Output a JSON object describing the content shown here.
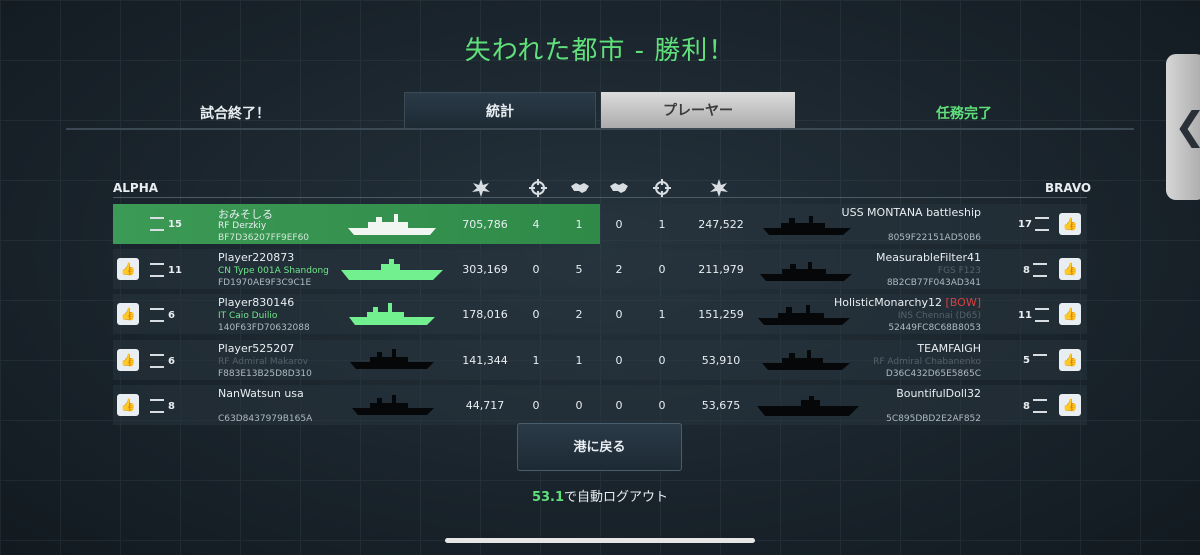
{
  "title": "失われた都市 - 勝利！",
  "header": {
    "left": "試合終了！",
    "right": "任務完了"
  },
  "tabs": [
    {
      "label": "統計"
    },
    {
      "label": "プレーヤー"
    }
  ],
  "teams": {
    "left": "ALPHA",
    "right": "BRAVO"
  },
  "rows": [
    {
      "l_rank": "15",
      "l_name": "おみそしる",
      "l_ship": "RF Derzkiy",
      "l_id": "BF7D36207FF9EF60",
      "dmg_l": "705,786",
      "c1": "4",
      "c2": "1",
      "c3": "0",
      "c4": "1",
      "dmg_r": "247,522",
      "r_name": "USS MONTANA battleship",
      "r_ship": "",
      "r_id": "8059F22151AD50B6",
      "r_rank": "17"
    },
    {
      "l_rank": "11",
      "l_name": "Player220873",
      "l_ship": "CN Type 001A Shandong",
      "l_id": "FD1970AE9F3C9C1E",
      "dmg_l": "303,169",
      "c1": "0",
      "c2": "5",
      "c3": "2",
      "c4": "0",
      "dmg_r": "211,979",
      "r_name": "MeasurableFilter41",
      "r_ship": "FGS F123",
      "r_id": "8B2CB77F043AD341",
      "r_rank": "8"
    },
    {
      "l_rank": "6",
      "l_name": "Player830146",
      "l_ship": "IT Caio Duilio",
      "l_id": "140F63FD70632088",
      "dmg_l": "178,016",
      "c1": "0",
      "c2": "2",
      "c3": "0",
      "c4": "1",
      "dmg_r": "151,259",
      "r_name": "HolisticMonarchy12",
      "r_tag": "[BOW]",
      "r_ship": "INS Chennai (D65)",
      "r_id": "52449FC8C68B8053",
      "r_rank": "11"
    },
    {
      "l_rank": "6",
      "l_name": "Player525207",
      "l_ship": "RF Admiral Makarov",
      "l_id": "F883E13B25D8D310",
      "dmg_l": "141,344",
      "c1": "1",
      "c2": "1",
      "c3": "0",
      "c4": "0",
      "dmg_r": "53,910",
      "r_name": "TEAMFAIGH",
      "r_ship": "RF Admiral Chabanenko",
      "r_id": "D36C432D65E5865C",
      "r_rank": "5"
    },
    {
      "l_rank": "8",
      "l_name": "NanWatsun usa",
      "l_ship": "",
      "l_id": "C63D8437979B165A",
      "dmg_l": "44,717",
      "c1": "0",
      "c2": "0",
      "c3": "0",
      "c4": "0",
      "dmg_r": "53,675",
      "r_name": "BountifulDoll32",
      "r_ship": "",
      "r_id": "5C895DBD2E2AF852",
      "r_rank": "8"
    }
  ],
  "back_button": "港に戻る",
  "logout": {
    "countdown": "53.1",
    "text": "で自動ログアウト"
  },
  "colors": {
    "accent_green": "#5fe07a",
    "highlight_row": "#3b9a55",
    "text": "#e8eef2"
  },
  "icons": [
    "explosion-icon",
    "crosshair-icon",
    "handshake-icon",
    "handshake-icon",
    "crosshair-icon",
    "explosion-icon",
    "thumbs-up-icon",
    "chevron-left-icon"
  ]
}
